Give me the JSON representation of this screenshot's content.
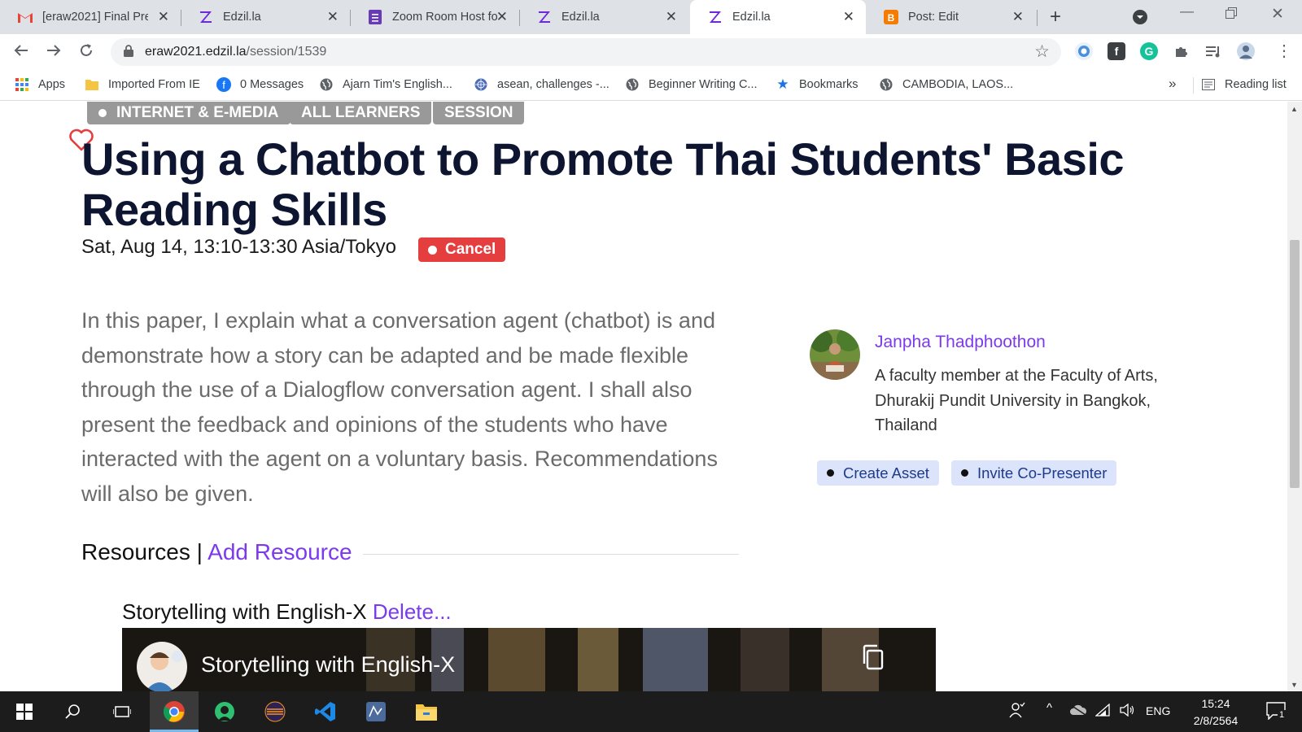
{
  "browser": {
    "tabs": [
      {
        "title": "[eraw2021] Final Pre",
        "icon": "gmail-icon"
      },
      {
        "title": "Edzil.la",
        "icon": "edzilla-icon"
      },
      {
        "title": "Zoom Room Host fo",
        "icon": "forms-icon"
      },
      {
        "title": "Edzil.la",
        "icon": "edzilla-icon"
      },
      {
        "title": "Edzil.la",
        "icon": "edzilla-icon"
      },
      {
        "title": "Post: Edit",
        "icon": "blogger-icon"
      }
    ],
    "url_host": "eraw2021.edzil.la",
    "url_path": "/session/1539",
    "bookmarks": [
      {
        "label": "Apps",
        "icon": "apps-grid-icon"
      },
      {
        "label": "Imported From IE",
        "icon": "folder-icon"
      },
      {
        "label": "0 Messages",
        "icon": "facebook-icon"
      },
      {
        "label": "Ajarn Tim's English...",
        "icon": "globe-icon"
      },
      {
        "label": "asean, challenges -...",
        "icon": "un-icon"
      },
      {
        "label": "Beginner Writing C...",
        "icon": "globe-icon"
      },
      {
        "label": "Bookmarks",
        "icon": "star-icon"
      },
      {
        "label": "CAMBODIA, LAOS...",
        "icon": "globe-icon"
      }
    ],
    "overflow_label": "»",
    "reading_list": "Reading list"
  },
  "session": {
    "tags": [
      "INTERNET & E-MEDIA",
      "ALL LEARNERS",
      "SESSION"
    ],
    "title": "Using a Chatbot to Promote Thai Students' Basic Reading Skills",
    "datetime": "Sat, Aug 14, 13:10-13:30 Asia/Tokyo",
    "cancel_label": "Cancel",
    "abstract": "In this paper, I explain what a conversation agent (chatbot) is and demonstrate how a story can be adapted and be made flexible through the use of a Dialogflow conversation agent. I shall also present the feedback and opinions of the students who have interacted with the agent on a voluntary basis. Recommendations will also be given."
  },
  "presenter": {
    "name": "Janpha Thadphoothon",
    "bio": "A faculty member at the Faculty of Arts, Dhurakij Pundit University in Bangkok, Thailand",
    "create_asset": "Create Asset",
    "invite": "Invite Co-Presenter"
  },
  "resources": {
    "heading": "Resources",
    "separator": "|",
    "add_label": "Add Resource",
    "items": [
      {
        "title": "Storytelling with English-X",
        "delete_label": "Delete...",
        "video_title": "Storytelling with English-X"
      }
    ]
  },
  "taskbar": {
    "language": "ENG",
    "time": "15:24",
    "date": "2/8/2564",
    "notifications": "1"
  },
  "colors": {
    "accent_purple": "#7c3aed",
    "cancel_red": "#e53e3e",
    "tag_gray": "#999999",
    "title_navy": "#0d1530"
  }
}
